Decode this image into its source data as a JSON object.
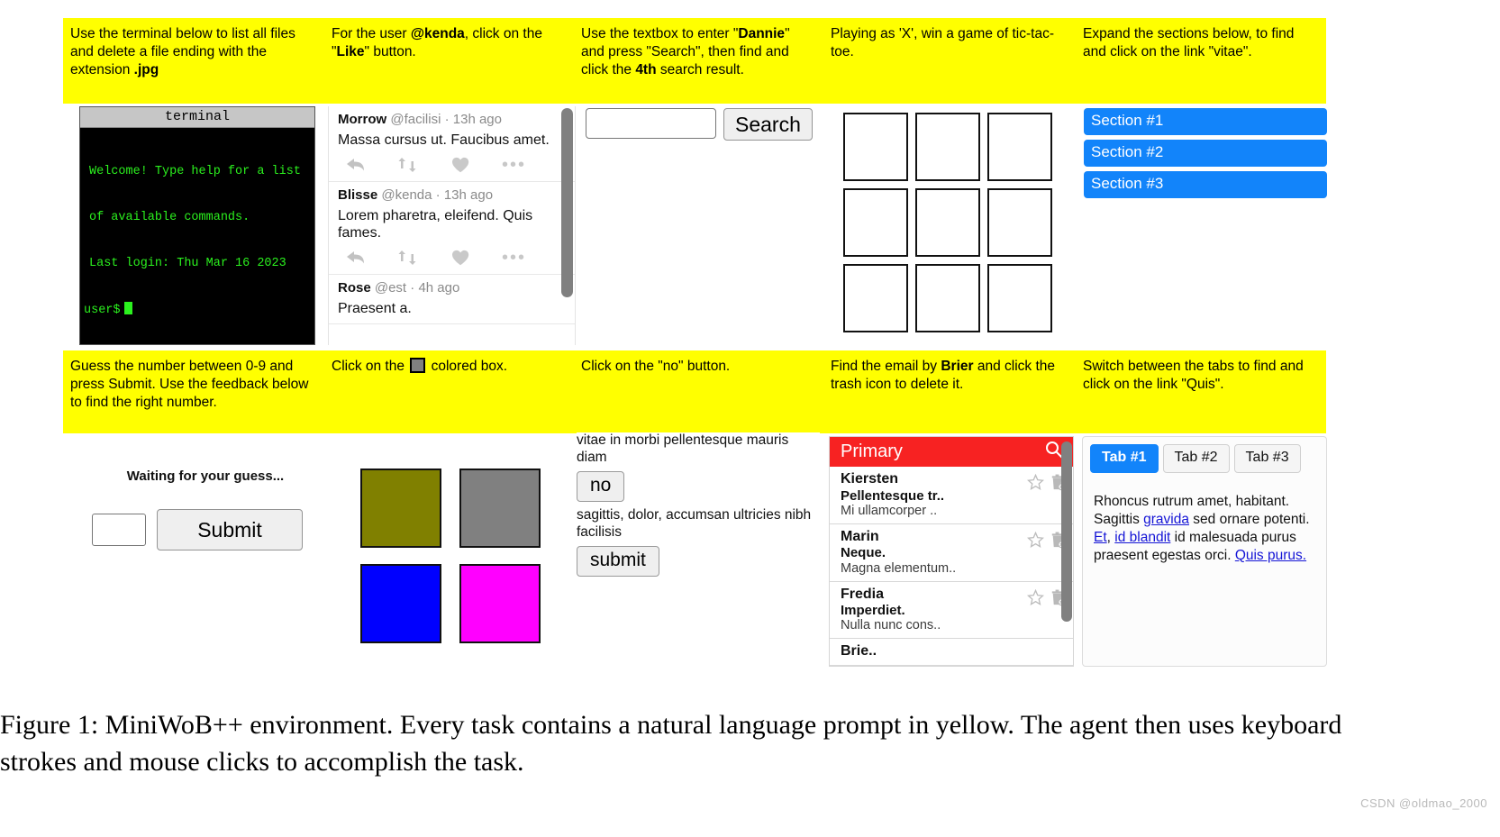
{
  "prompts_row1": [
    {
      "id": "terminal",
      "html": "Use the terminal below to list all files and delete a file ending with the extension <b>.jpg</b>"
    },
    {
      "id": "social",
      "html": "For the user <b>@kenda</b>, click on the \"<b>Like</b>\" button."
    },
    {
      "id": "search",
      "html": "Use the textbox to enter \"<b>Dannie</b>\" and press \"Search\", then find and click the <b>4th</b> search result."
    },
    {
      "id": "tictactoe",
      "html": "Playing as 'X', win a game of tic-tac-toe."
    },
    {
      "id": "sections",
      "html": "Expand the sections below, to find and click on the link \"vitae\"."
    }
  ],
  "prompts_row2": [
    {
      "id": "guess",
      "html": "Guess the number between 0-9 and press Submit. Use the feedback below to find the right number."
    },
    {
      "id": "colors",
      "html": "Click on the <span class=\"swatch-inline\" data-name=\"gray-swatch-icon\" data-interactable=\"false\"></span> colored box."
    },
    {
      "id": "clickbutton",
      "html": "Click on the \"no\" button."
    },
    {
      "id": "email",
      "html": "Find the email by <b>Brier</b> and click the trash icon to delete it."
    },
    {
      "id": "tabs",
      "html": "Switch between the tabs to find and click on the link \"Quis\"."
    }
  ],
  "terminal": {
    "title": "terminal",
    "lines": [
      "Welcome! Type help for a list",
      "of available commands.",
      "Last login: Thu Mar 16 2023"
    ],
    "prompt": "user$"
  },
  "social": {
    "tweets": [
      {
        "name": "Morrow",
        "handle": "@facilisi",
        "time": "13h ago",
        "body": "Massa cursus ut. Faucibus amet.",
        "has_actions": true
      },
      {
        "name": "Blisse",
        "handle": "@kenda",
        "time": "13h ago",
        "body": "Lorem pharetra, eleifend. Quis fames.",
        "has_actions": true
      },
      {
        "name": "Rose",
        "handle": "@est",
        "time": "4h ago",
        "body": "Praesent a.",
        "has_actions": false
      }
    ],
    "separator": "·",
    "more_dots": "•••"
  },
  "search": {
    "input_value": "",
    "placeholder": "",
    "button_label": "Search"
  },
  "tictactoe": {
    "cells": [
      "",
      "",
      "",
      "",
      "",
      "",
      "",
      "",
      ""
    ]
  },
  "sections": {
    "items": [
      "Section #1",
      "Section #2",
      "Section #3"
    ]
  },
  "guess": {
    "status": "Waiting for your guess...",
    "input_value": "",
    "submit_label": "Submit"
  },
  "colors": {
    "boxes": [
      {
        "name": "olive-box",
        "color": "#808000"
      },
      {
        "name": "gray-box",
        "color": "#808080"
      },
      {
        "name": "blue-box",
        "color": "#0000FF"
      },
      {
        "name": "magenta-box",
        "color": "#FF00FF"
      }
    ]
  },
  "clickbutton": {
    "text_above": "vitae in morbi pellentesque mauris diam",
    "button_no": "no",
    "text_middle": "sagittis, dolor, accumsan ultricies nibh facilisis",
    "button_submit": "submit"
  },
  "email": {
    "header_title": "Primary",
    "search_icon": "search-icon",
    "items": [
      {
        "sender": "Kiersten",
        "subject": "Pellentesque tr..",
        "body": "Mi ullamcorper .."
      },
      {
        "sender": "Marin",
        "subject": "Neque.",
        "body": "Magna elementum.."
      },
      {
        "sender": "Fredia",
        "subject": "Imperdiet.",
        "body": "Nulla nunc cons.."
      },
      {
        "sender": "Brie..",
        "subject": "",
        "body": ""
      }
    ]
  },
  "tabs": {
    "items": [
      {
        "label": "Tab #1",
        "active": true
      },
      {
        "label": "Tab #2",
        "active": false
      },
      {
        "label": "Tab #3",
        "active": false
      }
    ],
    "content_html": "Rhoncus rutrum amet, habitant. Sagittis <a href=\"#\" data-name=\"link-gravida\" data-interactable=\"true\">gravida</a> sed ornare potenti. <a href=\"#\" data-name=\"link-et\" data-interactable=\"true\">Et</a>, <a href=\"#\" data-name=\"link-id-blandit\" data-interactable=\"true\">id blandit</a> id malesuada purus praesent egestas orci. <a href=\"#\" data-name=\"link-quis-purus\" data-interactable=\"true\">Quis purus.</a>"
  },
  "caption": {
    "text": "Figure 1: MiniWoB++ environment. Every task contains a natural language prompt in yellow. The agent then uses keyboard strokes and mouse clicks to accomplish the task."
  },
  "watermark": {
    "text": "CSDN @oldmao_2000"
  },
  "colors_meta": {
    "prompt_yellow": "#ffff00",
    "section_blue": "#1284fa",
    "email_red": "#f72222",
    "terminal_green": "#2bf11e",
    "link_blue": "#1414d6"
  }
}
